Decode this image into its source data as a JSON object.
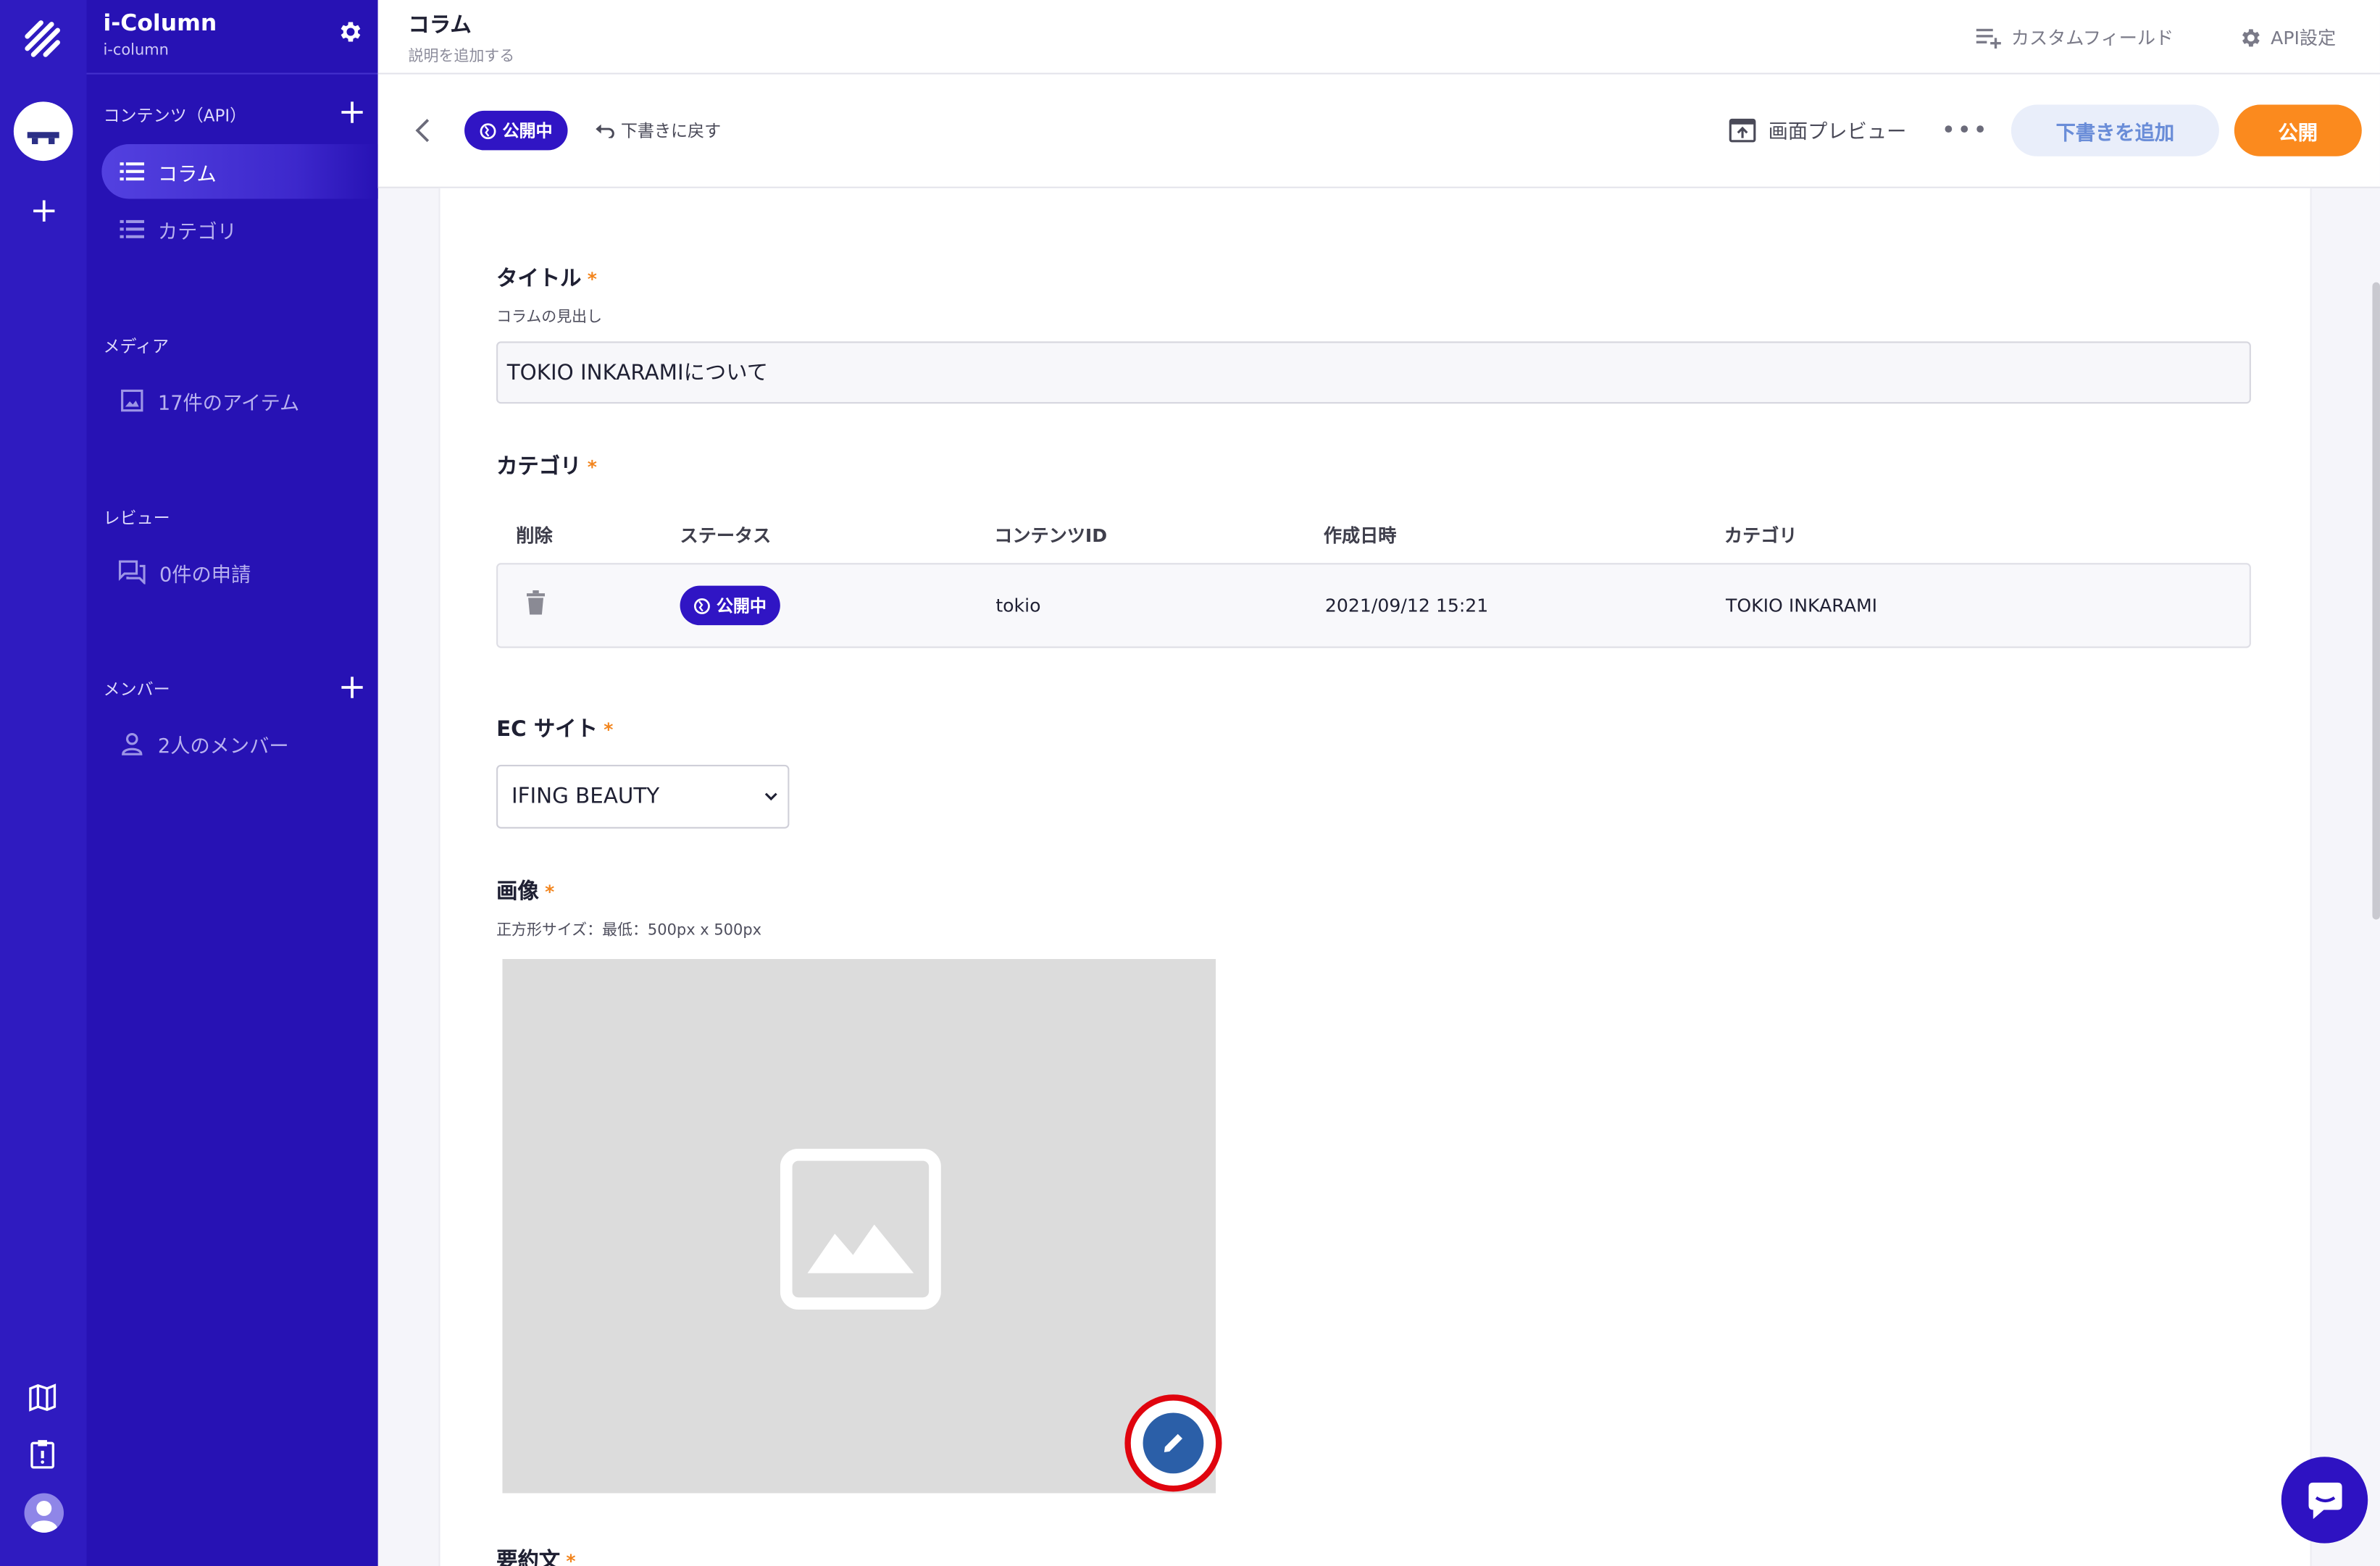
{
  "app": {
    "name": "i-Column",
    "id": "i-column"
  },
  "sidebar": {
    "contents_title": "コンテンツ（API）",
    "contents": [
      {
        "label": "コラム",
        "active": true
      },
      {
        "label": "カテゴリ",
        "active": false
      }
    ],
    "media_title": "メディア",
    "media_item": "17件のアイテム",
    "review_title": "レビュー",
    "review_item": "0件の申請",
    "members_title": "メンバー",
    "members_item": "2人のメンバー"
  },
  "header": {
    "title": "コラム",
    "description": "説明を追加する",
    "custom_field": "カスタムフィールド",
    "api_settings": "API設定"
  },
  "actions": {
    "status": "公開中",
    "revert": "下書きに戻す",
    "preview": "画面プレビュー",
    "more": "•••",
    "add_draft": "下書きを追加",
    "publish": "公開"
  },
  "form": {
    "title_label": "タイトル",
    "title_hint": "コラムの見出し",
    "title_value": "TOKIO INKARAMIについて",
    "category_label": "カテゴリ",
    "table": {
      "headers": [
        "削除",
        "ステータス",
        "コンテンツID",
        "作成日時",
        "カテゴリ"
      ],
      "row": {
        "status": "公開中",
        "content_id": "tokio",
        "created": "2021/09/12 15:21",
        "category": "TOKIO INKARAMI"
      }
    },
    "ec_label": "EC サイト",
    "ec_value": "IFING BEAUTY",
    "image_label": "画像",
    "image_hint": "正方形サイズ：最低：500px x 500px",
    "summary_label": "要約文",
    "required_mark": "*"
  },
  "colors": {
    "brand": "#2712b4",
    "accent_orange": "#fb8a1e",
    "status_pill": "#3015c4",
    "highlight_ring": "#e0040e"
  }
}
